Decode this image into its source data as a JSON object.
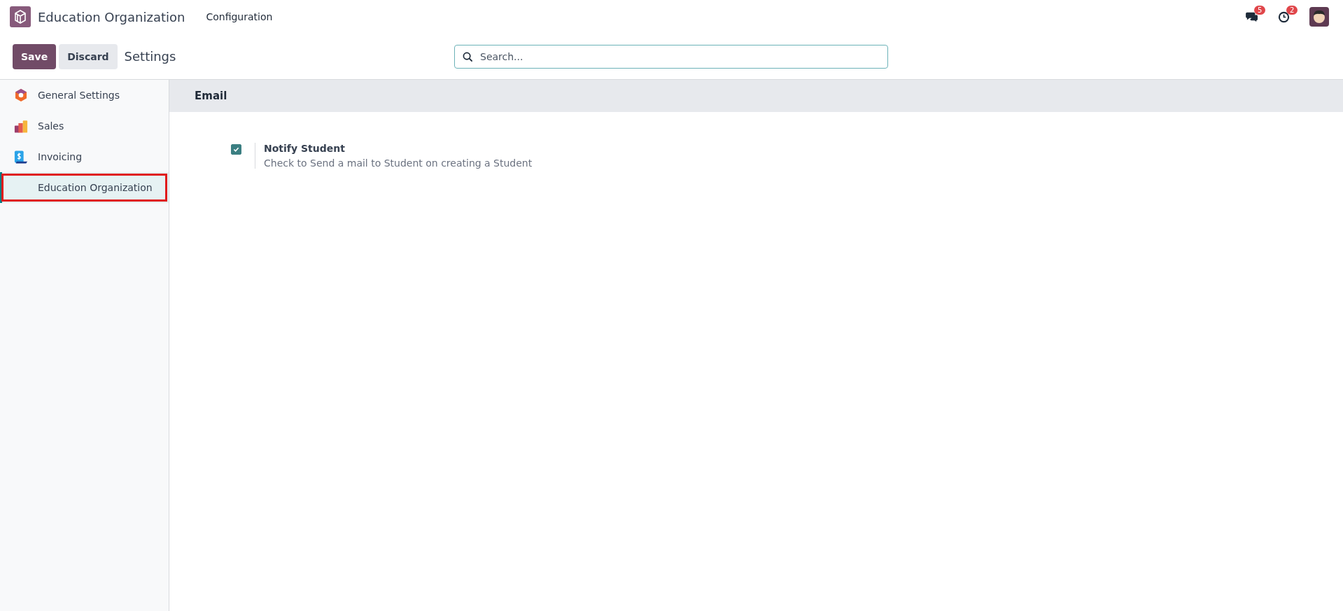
{
  "navbar": {
    "app_name": "Education Organization",
    "menus": [
      "Configuration"
    ],
    "messages_badge": "5",
    "activities_badge": "2"
  },
  "control_panel": {
    "save": "Save",
    "discard": "Discard",
    "title": "Settings"
  },
  "search": {
    "placeholder": "Search..."
  },
  "sidebar": {
    "items": [
      {
        "label": "General Settings",
        "kind": "hexagon",
        "selected": false
      },
      {
        "label": "Sales",
        "kind": "bars",
        "selected": false
      },
      {
        "label": "Invoicing",
        "kind": "invoice",
        "selected": false
      },
      {
        "label": "Education Organization",
        "kind": "none",
        "selected": true
      }
    ]
  },
  "section": {
    "title": "Email",
    "settings": [
      {
        "label": "Notify Student",
        "description": "Check to Send a mail to Student on creating a Student",
        "checked": true
      }
    ]
  }
}
